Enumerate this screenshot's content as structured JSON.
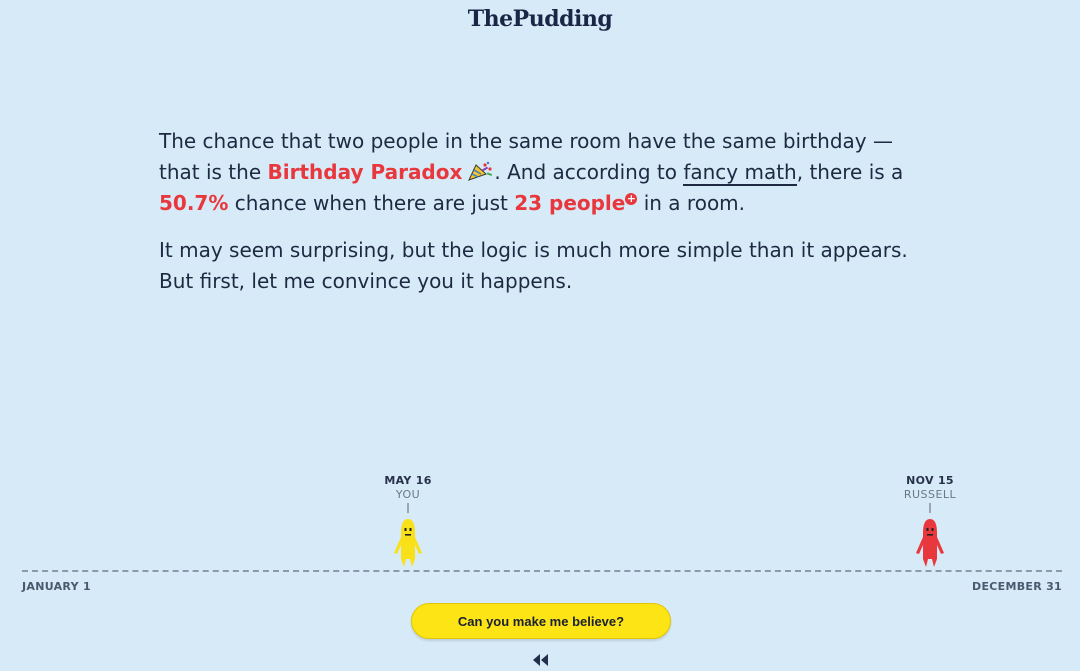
{
  "header": {
    "logo_text": "ThePudding"
  },
  "intro": {
    "p1_a": "The chance that two people in the same room have the same birthday — that is the ",
    "p1_highlight": "Birthday Paradox",
    "party_icon": "party-popper-icon",
    "p1_b": ". And according to ",
    "p1_link": "fancy math",
    "p1_c": ", there is a ",
    "p1_percent": "50.7%",
    "p1_d": " chance when there are just ",
    "p1_people": "23 people",
    "plus_icon": "plus-circle-icon",
    "p1_e": " in a room.",
    "p2": "It may seem surprising, but the logic is much more simple than it appears. But first, let me convince you it happens."
  },
  "timeline": {
    "start_label": "JANUARY 1",
    "end_label": "DECEMBER 31",
    "people": [
      {
        "date": "MAY 16",
        "name": "YOU",
        "color": "#f9e11a"
      },
      {
        "date": "NOV 15",
        "name": "RUSSELL",
        "color": "#e8383d"
      }
    ]
  },
  "cta": {
    "label": "Can you make me believe?"
  },
  "controls": {
    "rewind_icon": "rewind-icon"
  },
  "colors": {
    "background": "#d6eaf8",
    "accent_red": "#e8383d",
    "button_yellow": "#fde415",
    "text_dark": "#1e2a42"
  }
}
